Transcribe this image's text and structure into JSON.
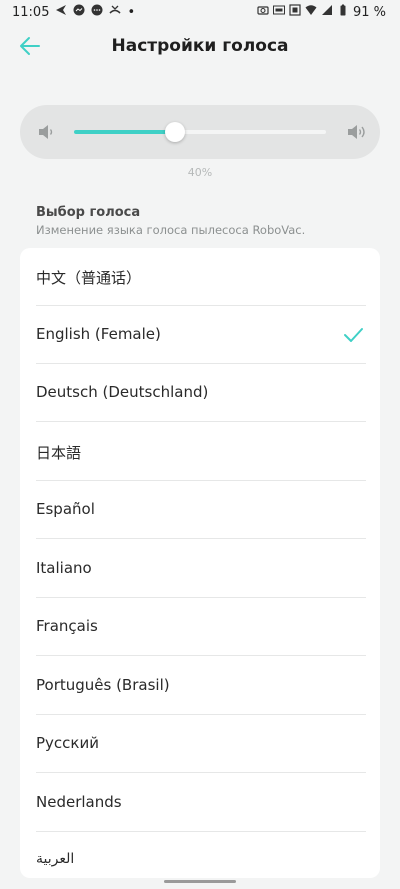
{
  "status_bar": {
    "time": "11:05",
    "battery": "91 %",
    "dot": "•"
  },
  "header": {
    "title": "Настройки голоса"
  },
  "volume": {
    "level": 0.4,
    "label": "40%"
  },
  "section": {
    "title": "Выбор голоса",
    "subtitle": "Изменение языка голоса пылесоса RoboVac."
  },
  "languages": [
    {
      "label": "中文（普通话）",
      "selected": false
    },
    {
      "label": "English (Female)",
      "selected": true
    },
    {
      "label": "Deutsch (Deutschland)",
      "selected": false
    },
    {
      "label": "日本語",
      "selected": false
    },
    {
      "label": "Español",
      "selected": false
    },
    {
      "label": "Italiano",
      "selected": false
    },
    {
      "label": "Français",
      "selected": false
    },
    {
      "label": "Português (Brasil)",
      "selected": false
    },
    {
      "label": "Русский",
      "selected": false
    },
    {
      "label": "Nederlands",
      "selected": false
    },
    {
      "label": "العربية",
      "selected": false
    }
  ],
  "colors": {
    "accent": "#3fd0c6",
    "background": "#f3f4f4"
  }
}
